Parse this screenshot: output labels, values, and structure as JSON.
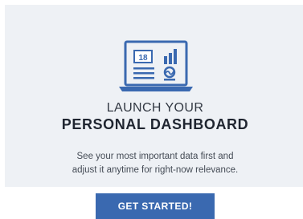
{
  "hero": {
    "calendar_number": "18",
    "icon": "laptop-dashboard-icon"
  },
  "title": {
    "line1": "LAUNCH YOUR",
    "line2": "PERSONAL DASHBOARD"
  },
  "description": {
    "line1": "See your most important data first and",
    "line2": "adjust it anytime for right-now relevance."
  },
  "cta": {
    "label": "GET STARTED!"
  },
  "colors": {
    "card_background": "#eef1f5",
    "accent": "#3a69b0",
    "heading": "#1f2530",
    "body_text": "#444b55"
  }
}
